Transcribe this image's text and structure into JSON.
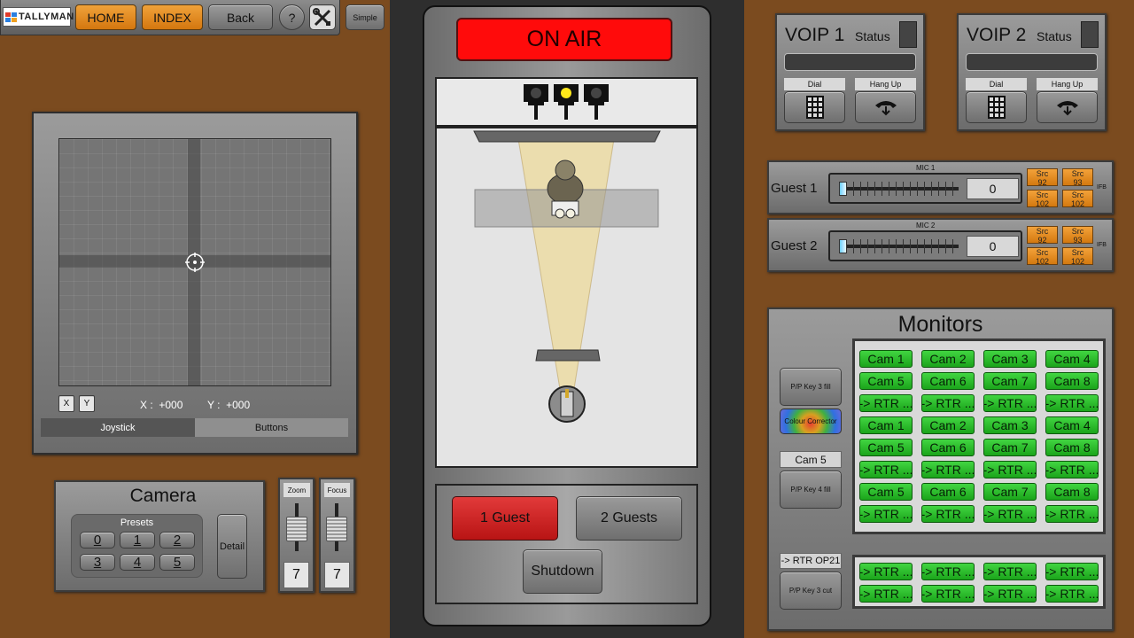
{
  "topbar": {
    "logo": "TALLYMAN",
    "home": "HOME",
    "index": "INDEX",
    "back": "Back",
    "help": "?",
    "simple": "Simple"
  },
  "joystick": {
    "x_btn": "X",
    "y_btn": "Y",
    "x_readout": "X :  +000",
    "y_readout": "Y :  +000",
    "tab_joystick": "Joystick",
    "tab_buttons": "Buttons"
  },
  "camera": {
    "title": "Camera",
    "presets_label": "Presets",
    "presets": [
      "0",
      "1",
      "2",
      "3",
      "4",
      "5"
    ],
    "detail": "Detail",
    "zoom_label": "Zoom",
    "zoom_value": "7",
    "zoom_level": 0.6,
    "focus_label": "Focus",
    "focus_value": "7",
    "focus_level": 0.6
  },
  "studio": {
    "on_air": "ON AIR",
    "guest1": "1 Guest",
    "guest2": "2 Guests",
    "shutdown": "Shutdown"
  },
  "voip": [
    {
      "title": "VOIP 1",
      "status": "Status",
      "dial": "Dial",
      "hangup": "Hang Up"
    },
    {
      "title": "VOIP 2",
      "status": "Status",
      "dial": "Dial",
      "hangup": "Hang Up"
    }
  ],
  "mics": [
    {
      "mic": "MIC 1",
      "guest": "Guest 1",
      "value": "0",
      "level": 0.0,
      "src": [
        "Src\n92",
        "Src\n93",
        "Src\n102",
        "Src\n102"
      ],
      "ifb": "IFB"
    },
    {
      "mic": "MIC 2",
      "guest": "Guest 2",
      "value": "0",
      "level": 0.0,
      "src": [
        "Src\n92",
        "Src\n93",
        "Src\n102",
        "Src\n102"
      ],
      "ifb": "IFB"
    }
  ],
  "monitors": {
    "title": "Monitors",
    "pp_key3_fill": "P/P Key 3 fill",
    "colour_corrector": "Colour Corrector",
    "cam5_label": "Cam 5",
    "pp_key4_fill": "P/P Key 4 fill",
    "rtr_op21": "-> RTR OP21",
    "pp_key3_cut": "P/P Key 3 cut",
    "grid": [
      [
        "Cam 1",
        "Cam 2",
        "Cam 3",
        "Cam 4"
      ],
      [
        "Cam 5",
        "Cam 6",
        "Cam 7",
        "Cam 8"
      ],
      [
        "-> RTR ...",
        "-> RTR ...",
        "-> RTR ...",
        "-> RTR ..."
      ],
      [
        "Cam 1",
        "Cam 2",
        "Cam 3",
        "Cam 4"
      ],
      [
        "Cam 5",
        "Cam 6",
        "Cam 7",
        "Cam 8"
      ],
      [
        "-> RTR ...",
        "-> RTR ...",
        "-> RTR ...",
        "-> RTR ..."
      ],
      [
        "Cam 5",
        "Cam 6",
        "Cam 7",
        "Cam 8"
      ],
      [
        "-> RTR ...",
        "-> RTR ...",
        "-> RTR ...",
        "-> RTR ..."
      ]
    ],
    "grid2": [
      [
        "-> RTR ...",
        "-> RTR ...",
        "-> RTR ...",
        "-> RTR ..."
      ],
      [
        "-> RTR ...",
        "-> RTR ...",
        "-> RTR ...",
        "-> RTR ..."
      ]
    ]
  }
}
